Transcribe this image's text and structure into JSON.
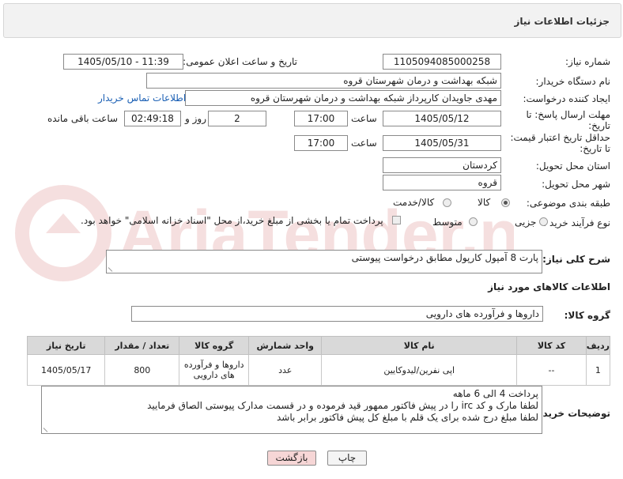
{
  "header": {
    "title": "جزئیات اطلاعات نیاز"
  },
  "fields": {
    "need_number_label": "شماره نیاز:",
    "need_number": "1105094085000258",
    "announce_label": "تاریخ و ساعت اعلان عمومی:",
    "announce_value": "1405/05/10 - 11:39",
    "buyer_org_label": "نام دستگاه خریدار:",
    "buyer_org": "شبکه بهداشت و درمان شهرستان قروه",
    "requester_label": "ایجاد کننده درخواست:",
    "requester": "مهدی جاویدان کارپرداز شبکه بهداشت و درمان شهرستان قروه",
    "contact_link": "اطلاعات تماس خریدار",
    "deadline_label_1": "مهلت ارسال پاسخ: تا",
    "deadline_label_2": "تاریخ:",
    "deadline_date": "1405/05/12",
    "time_word": "ساعت",
    "deadline_time": "17:00",
    "days_value": "2",
    "days_word": "روز و",
    "remaining_time": "02:49:18",
    "remaining_word": "ساعت باقی مانده",
    "validity_label_1": "حداقل تاریخ اعتبار قیمت:",
    "validity_label_2": "تا تاریخ:",
    "validity_date": "1405/05/31",
    "validity_time": "17:00",
    "province_label": "استان محل تحویل:",
    "province": "کردستان",
    "city_label": "شهر محل تحویل:",
    "city": "قروه",
    "category_label": "طبقه بندی موضوعی:",
    "category_options": [
      "کالا",
      "کالا/خدمت"
    ],
    "category_selected": "کالا",
    "process_label": "نوع فرآیند خرید :",
    "process_options": [
      "جزیی",
      "متوسط"
    ],
    "payment_note": "پرداخت تمام یا بخشی از مبلغ خرید،از محل \"اسناد خزانه اسلامی\" خواهد بود.",
    "description_label": "شرح کلی نیاز:",
    "description": "پارت 8 آمپول کارپول مطابق درخواست پیوستی"
  },
  "goods_section": {
    "title": "اطلاعات کالاهای مورد نیاز",
    "group_label": "گروه کالا:",
    "group_value": "داروها و فرآورده های دارویی"
  },
  "table": {
    "headers": [
      "ردیف",
      "کد کالا",
      "نام کالا",
      "واحد شمارش",
      "گروه کالا",
      "تعداد / مقدار",
      "تاریخ نیاز"
    ],
    "rows": [
      [
        "1",
        "--",
        "اپی نفرین/لیدوکایین",
        "عدد",
        "داروها و فرآورده های دارویی",
        "800",
        "1405/05/17"
      ]
    ]
  },
  "buyer_notes": {
    "label": "توضیحات خریدار:",
    "lines": [
      "پرداخت 4 الی 6 ماهه",
      "لطفا مارک و کد irc  را در پیش فاکتور ممهور قید فرموده و در قسمت مدارک پیوستی الصاق فرمایید",
      "لطفا مبلغ درج شده برای یک قلم با مبلغ کل پیش فاکتور برابر باشد"
    ]
  },
  "buttons": {
    "print": "چاپ",
    "back": "بازگشت"
  },
  "watermark": {
    "text": "AriaTender.neT"
  },
  "colors": {
    "link": "#1a5fb4",
    "back_button_bg": "#f6d6d6",
    "header_bg": "#f2f2f2",
    "table_header_bg": "#d9d9d9"
  }
}
